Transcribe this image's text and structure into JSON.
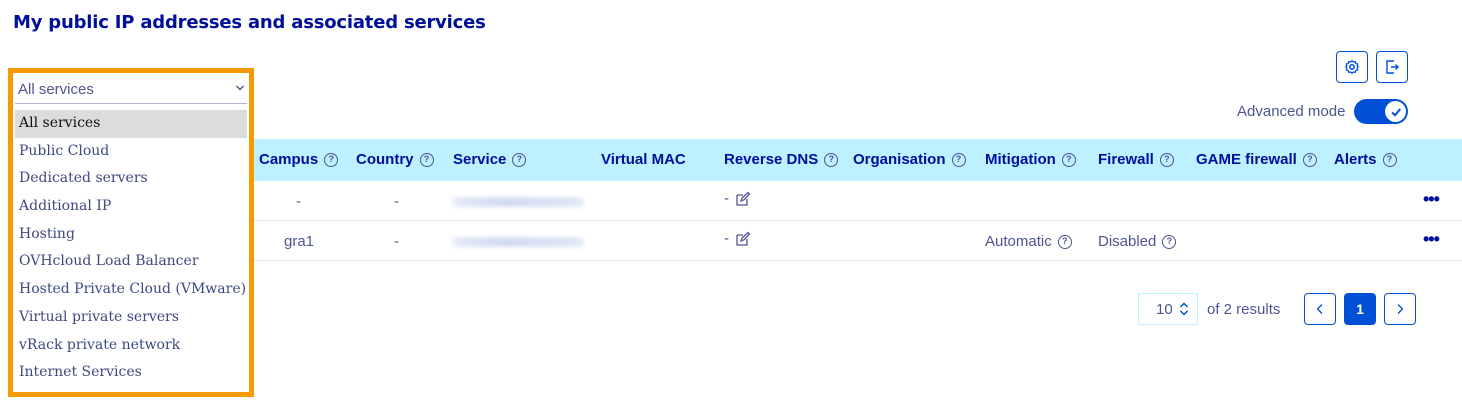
{
  "page": {
    "title": "My public IP addresses and associated services"
  },
  "toolbar": {
    "settings_icon": "gear-icon",
    "export_icon": "export-icon"
  },
  "advanced_mode": {
    "label": "Advanced mode",
    "enabled": true
  },
  "filter": {
    "selected": "All services",
    "options": [
      "All services",
      "Public Cloud",
      "Dedicated servers",
      "Additional IP",
      "Hosting",
      "OVHcloud Load Balancer",
      "Hosted Private Cloud (VMware)",
      "Virtual private servers",
      "vRack private network",
      "Internet Services"
    ]
  },
  "table": {
    "columns": {
      "campus": "Campus",
      "country": "Country",
      "service": "Service",
      "virtual_mac": "Virtual MAC",
      "reverse_dns": "Reverse DNS",
      "organisation": "Organisation",
      "mitigation": "Mitigation",
      "firewall": "Firewall",
      "game_firewall": "GAME firewall",
      "alerts": "Alerts"
    },
    "rows": [
      {
        "campus": "-",
        "country": "-",
        "reverse_dns": "-",
        "mitigation": "",
        "firewall": ""
      },
      {
        "campus": "gra1",
        "country": "-",
        "reverse_dns": "-",
        "mitigation": "Automatic",
        "firewall": "Disabled"
      }
    ]
  },
  "pagination": {
    "page_size": "10",
    "results": "of 2 results",
    "current_page": "1"
  },
  "colors": {
    "accent": "#0050d7",
    "header_bg": "#bef1ff",
    "title": "#000e9c",
    "highlight_frame": "#f59a00"
  }
}
